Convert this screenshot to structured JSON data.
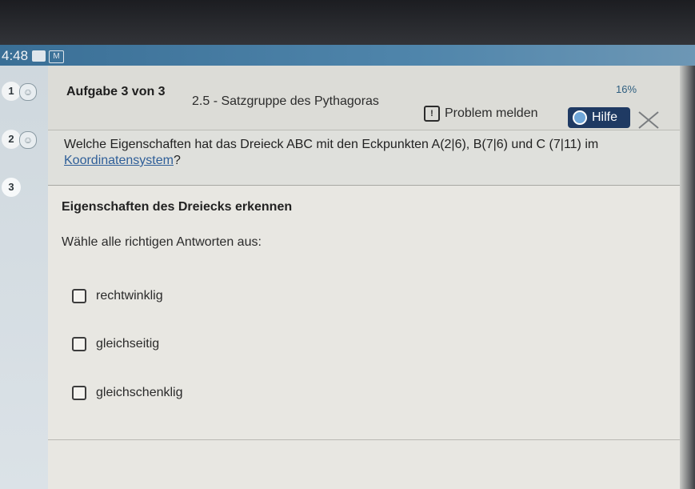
{
  "status_bar": {
    "time": "4:48",
    "app_icon_label": "M",
    "battery": "16%"
  },
  "sidebar": {
    "steps": [
      {
        "number": "1"
      },
      {
        "number": "2"
      },
      {
        "number": "3"
      }
    ]
  },
  "header": {
    "task_count": "Aufgabe 3 von 3",
    "task_title": "2.5 - Satzgruppe des Pythagoras",
    "report_label": "Problem melden",
    "help_label": "Hilfe"
  },
  "question": {
    "text_part1": "Welche Eigenschaften hat das Dreieck ABC mit den Eckpunkten A(2|6), B(7|6) und C (7|11) im",
    "link_text": "Koordinatensystem",
    "text_part2": "?"
  },
  "exercise": {
    "subtitle": "Eigenschaften des Dreiecks erkennen",
    "instruction": "Wähle alle richtigen Antworten aus:",
    "options": [
      {
        "label": "rechtwinklig",
        "checked": false
      },
      {
        "label": "gleichseitig",
        "checked": false
      },
      {
        "label": "gleichschenklig",
        "checked": false
      }
    ]
  },
  "colors": {
    "statusbar_blue": "#4f85ab",
    "help_button_bg": "#1f3a63",
    "link_color": "#2e5e98",
    "background": "#e8e7e2"
  },
  "icons": [
    "report-icon",
    "help-lifebuoy-icon",
    "close-icon",
    "smiley-icon",
    "checkbox-icon"
  ]
}
